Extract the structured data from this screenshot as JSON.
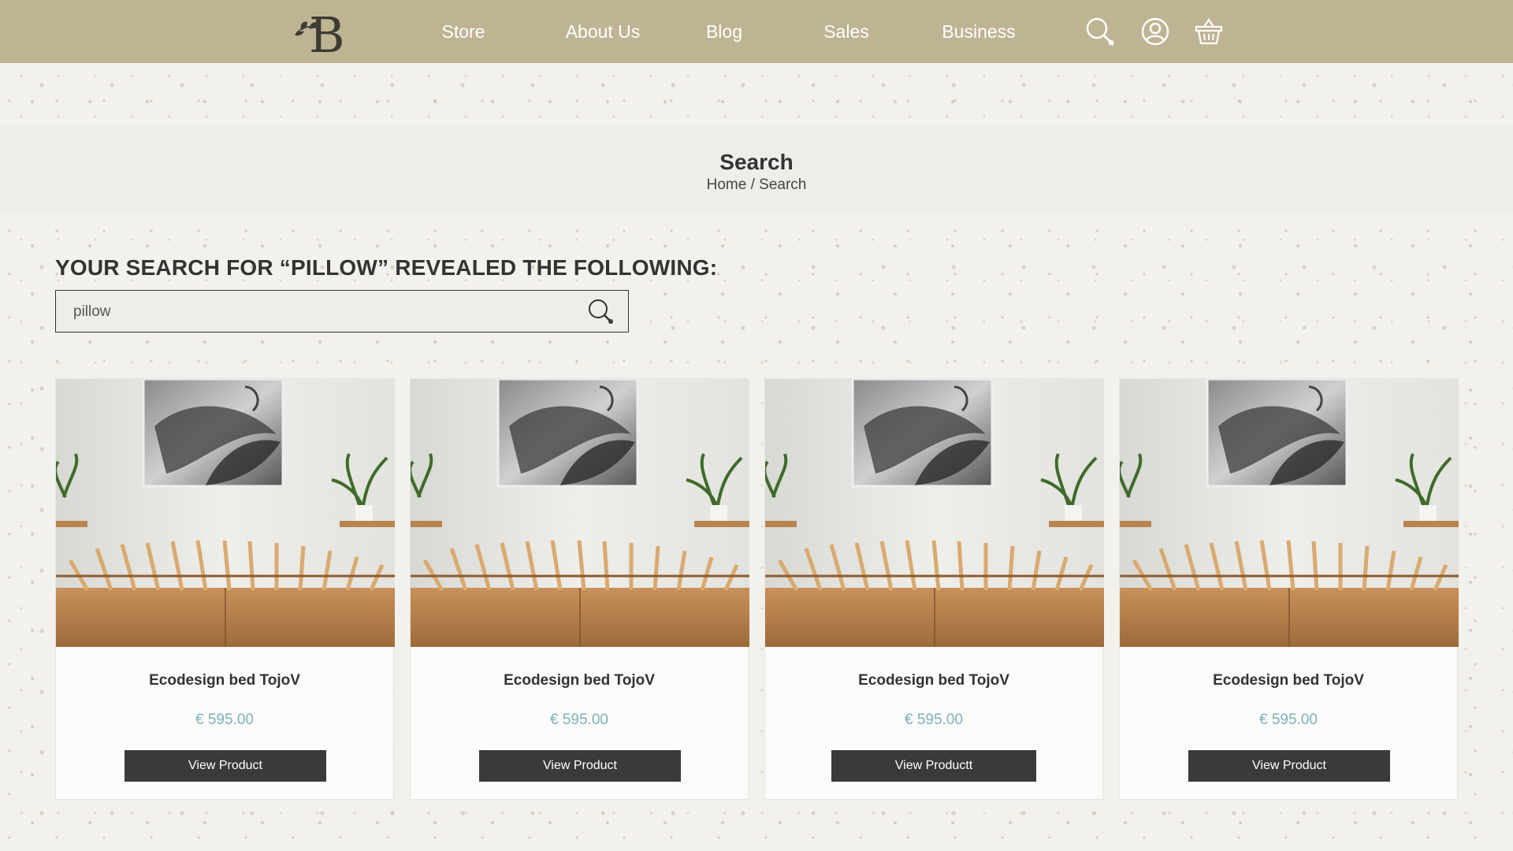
{
  "header": {
    "logo_letter": "B",
    "nav": [
      "Store",
      "About Us",
      "Blog",
      "Sales",
      "Business"
    ],
    "icons": [
      "search-icon",
      "user-account-icon",
      "shopping-basket-icon"
    ],
    "background_color": "#beb493"
  },
  "banner": {
    "title": "Search",
    "breadcrumb_home": "Home",
    "breadcrumb_separator": " / ",
    "breadcrumb_current": "Search"
  },
  "results": {
    "heading": "YOUR SEARCH FOR “PILLOW” REVEALED THE FOLLOWING:",
    "search_value": "pillow"
  },
  "products": [
    {
      "name": "Ecodesign bed TojoV",
      "price": "€ 595.00",
      "button": "View Product"
    },
    {
      "name": "Ecodesign bed TojoV",
      "price": "€ 595.00",
      "button": "View Product"
    },
    {
      "name": "Ecodesign bed TojoV",
      "price": "€ 595.00",
      "button": "View Productt"
    },
    {
      "name": "Ecodesign bed TojoV",
      "price": "€ 595.00",
      "button": "View Product"
    }
  ],
  "colors": {
    "accent_price": "#7cb2b8",
    "button_bg": "#3a3a3a",
    "banner_bg": "#ededea"
  }
}
